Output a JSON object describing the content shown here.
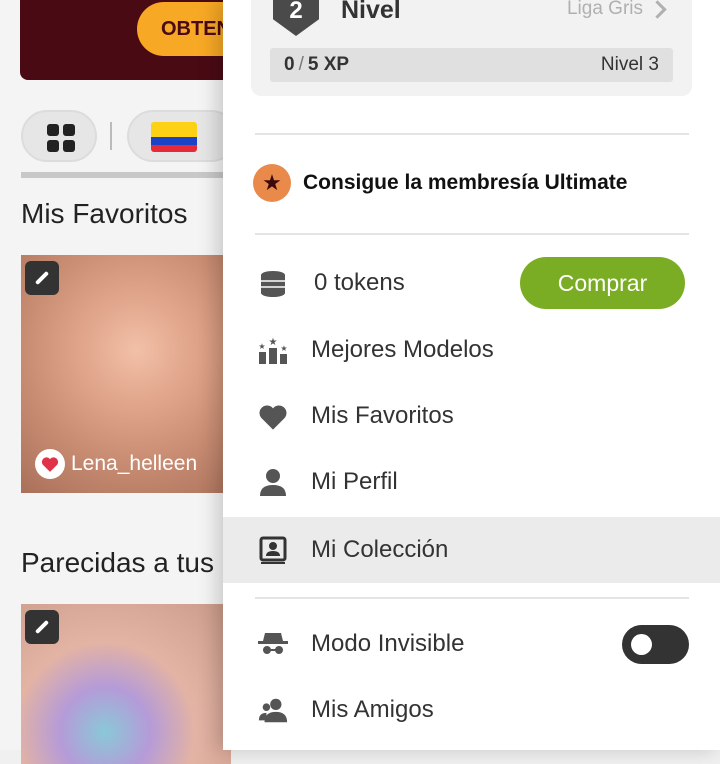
{
  "background": {
    "promo_button_label": "OBTEN",
    "flag": "colombia-flag",
    "favorites_title": "Mis Favoritos",
    "favorite_card": {
      "username": "Lena_helleen"
    },
    "similar_title": "Parecidas a tus"
  },
  "drawer": {
    "level": {
      "number": "2",
      "label": "Nivel",
      "league": "Liga Gris",
      "xp_current": "0",
      "xp_separator": "/",
      "xp_total": "5 XP",
      "next_level": "Nivel 3"
    },
    "ultimate_label": "Consigue la membresía Ultimate",
    "tokens_label": "0 tokens",
    "buy_label": "Comprar",
    "menu": [
      {
        "label": "Mejores Modelos",
        "icon": "top-models-icon"
      },
      {
        "label": "Mis Favoritos",
        "icon": "heart-icon"
      },
      {
        "label": "Mi Perfil",
        "icon": "user-icon"
      },
      {
        "label": "Mi Colección",
        "icon": "collection-icon"
      }
    ],
    "invisible_label": "Modo Invisible",
    "invisible_on": false,
    "friends_label": "Mis Amigos"
  },
  "colors": {
    "buy_button": "#7aad23",
    "ultimate_icon": "#e9894a",
    "promo_background": "#4a0a14",
    "promo_button": "#f7a825"
  }
}
